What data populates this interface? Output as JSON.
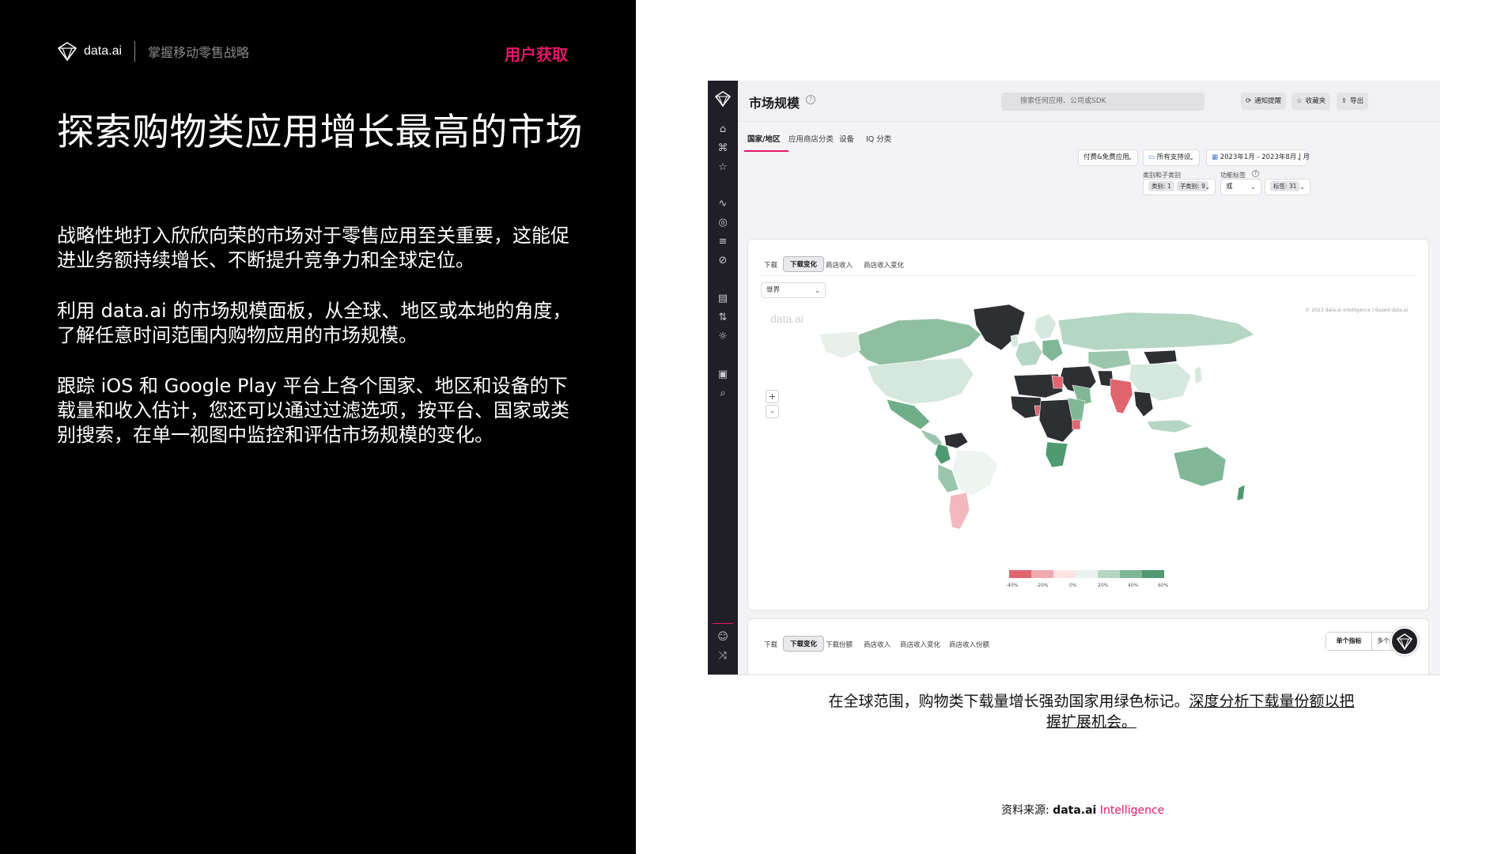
{
  "brand": {
    "name": "data.ai",
    "subtitle": "掌握移动零售战略"
  },
  "section_tag": "用户获取",
  "headline": "探索购物类应用增长最高的市场",
  "paragraphs": [
    "战略性地打入欣欣向荣的市场对于零售应用至关重要，这能促进业务额持续增长、不断提升竞争力和全球定位。",
    "利用 data.ai 的市场规模面板，从全球、地区或本地的角度，了解任意时间范围内购物应用的市场规模。",
    "跟踪 iOS 和 Google Play 平台上各个国家、地区和设备的下载量和收入估计，您还可以通过过滤选项，按平台、国家或类别搜索，在单一视图中监控和评估市场规模的变化。"
  ],
  "app": {
    "title": "市场规模",
    "search_placeholder": "搜索任何应用、公司或SDK",
    "buttons": {
      "alert": "通知提醒",
      "favorite": "收藏夹",
      "export": "导出"
    },
    "tabs": [
      "国家/地区",
      "应用商店分类",
      "设备",
      "IQ 分类"
    ],
    "filters": {
      "app_type": "付费&免费应用",
      "devices": "所有支持设",
      "date_range": "2023年1月 - 2023年8月 | 月",
      "category_label": "类别和子类别",
      "category_chip1": "类别: 1",
      "category_chip2": "子类别: 9",
      "feature_label": "功能标签",
      "feature_op": "或",
      "feature_chip": "标签: 31"
    },
    "map_card": {
      "subtabs": [
        "下载",
        "下载变化",
        "商店收入",
        "商店收入变化"
      ],
      "region": "世界",
      "watermark": "data.ai",
      "copyright": "© 2023 data.ai Intelligence | Based data.ai",
      "zoom_in": "+",
      "zoom_out": "-",
      "legend_ticks": [
        "-40%",
        "-20%",
        "0%",
        "20%",
        "40%",
        "60%"
      ],
      "legend_colors": [
        "#e0656f",
        "#f0a9ae",
        "#fbe3e4",
        "#e9f3ee",
        "#b5d6c3",
        "#7fb797",
        "#4f9a71"
      ]
    },
    "bottom_card": {
      "subtabs": [
        "下载",
        "下载变化",
        "下载份额",
        "商店收入",
        "商店收入变化",
        "商店收入份额"
      ],
      "toggle_on": "单个指标",
      "toggle_off": "多个"
    }
  },
  "caption": {
    "text": "在全球范围，购物类下载量增长强劲国家用绿色标记。",
    "link": "深度分析下载量份额以把握扩展机会。"
  },
  "source": {
    "label": "资料来源:",
    "brand": "data.ai",
    "suffix": "Intelligence"
  }
}
